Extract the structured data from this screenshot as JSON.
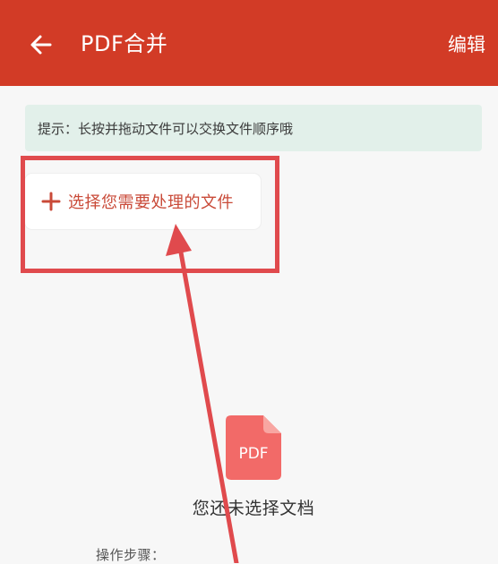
{
  "app_bar": {
    "title": "PDF合并",
    "edit_label": "编辑",
    "background_color": "#d23b26"
  },
  "tip": {
    "text": "提示：长按并拖动文件可以交换文件顺序哦"
  },
  "select_file": {
    "label": "选择您需要处理的文件",
    "icon": "plus-icon",
    "accent_color": "#c94a38"
  },
  "empty_state": {
    "icon_label": "PDF",
    "icon": "pdf-file-icon",
    "text": "您还未选择文档"
  },
  "steps": {
    "label": "操作步骤："
  },
  "annotation": {
    "color": "#e04a4d"
  }
}
